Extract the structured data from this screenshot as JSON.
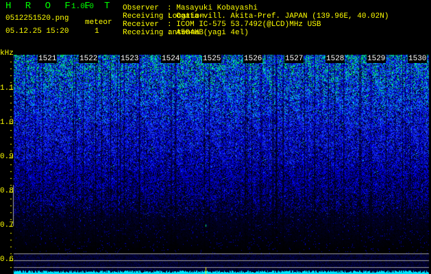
{
  "header": {
    "app_name": "H R O F F T",
    "version": "1.0.0",
    "filename": "0512251520.png",
    "datetime": "05.12.25 15:20",
    "meteor_label": "meteor",
    "meteor_count": "1",
    "info": [
      {
        "label": "Observer",
        "value": ": Masayuki Kobayashi"
      },
      {
        "label": "Receiving Location",
        "value": ": Ogata-vill. Akita-Pref. JAPAN (139.96E, 40.02N)"
      },
      {
        "label": "Receiver",
        "value": ": ICOM IC-575 53.7492(@LCD)MHz USB"
      },
      {
        "label": "Receiving antenna",
        "value": ": A504HB(yagi 4el)"
      }
    ]
  },
  "colors": {
    "text": "#ffff00",
    "title": "#00ff00",
    "signal_low": "#0000a0",
    "signal_mid": "#2050ff",
    "signal_high": "#00ff60",
    "baseline": "#00e5ff"
  },
  "chart_data": {
    "type": "heatmap",
    "ylabel": "kHz",
    "y_ticks": [
      "1.1",
      "1.0",
      "0.9",
      "0.8",
      "0.7",
      "0.6"
    ],
    "y_tick_values": [
      1.1,
      1.0,
      0.9,
      0.8,
      0.7,
      0.6
    ],
    "ylim": [
      0.56,
      1.2
    ],
    "x_ticks": [
      "1521",
      "1522",
      "1523",
      "1524",
      "1525",
      "1526",
      "1527",
      "1528",
      "1529",
      "1530"
    ],
    "xlim_minutes": [
      1520,
      1530.5
    ],
    "reference_lines_khz": [
      0.62,
      0.6,
      0.58
    ],
    "meteor_detections_minute": [
      1525
    ]
  }
}
